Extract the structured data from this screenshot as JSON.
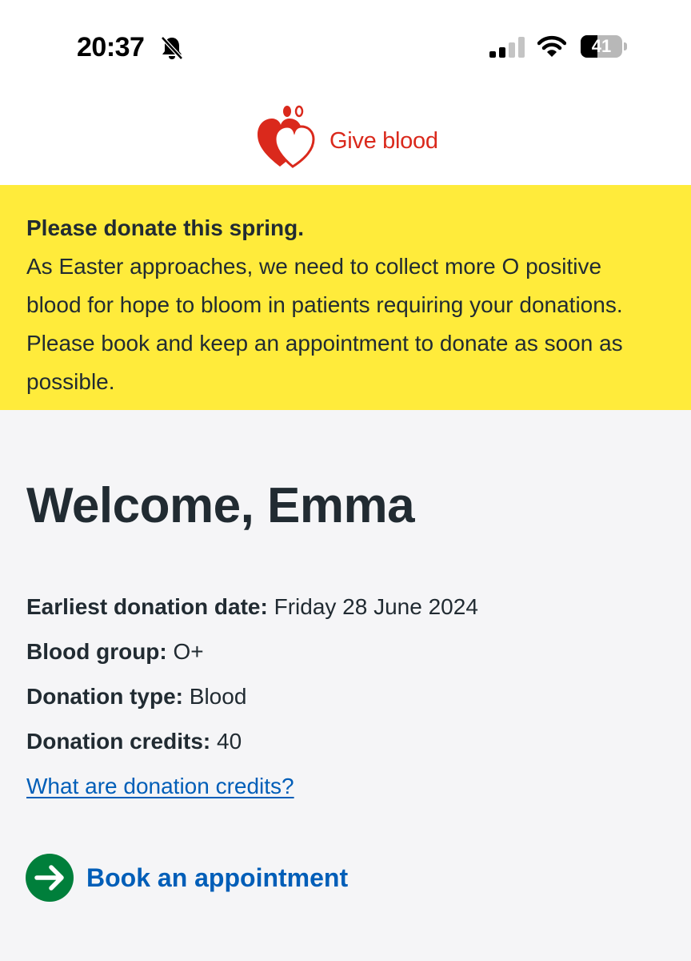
{
  "status_bar": {
    "time": "20:37",
    "battery_level": "41",
    "battery_fraction": 0.41,
    "icons": [
      "bell-slash-icon",
      "cellular-signal-icon",
      "wifi-icon",
      "battery-icon"
    ]
  },
  "header": {
    "logo_text": "Give blood",
    "brand_color": "#da291c"
  },
  "banner": {
    "title": "Please donate this spring.",
    "body": "As Easter approaches, we need to collect more O positive blood for hope to bloom in patients requiring your donations. Please book and keep an appointment to donate as soon as possible.",
    "background_color": "#ffeb3b"
  },
  "welcome": {
    "heading": "Welcome, Emma"
  },
  "details": [
    {
      "label": "Earliest donation date:",
      "value": "Friday 28 June 2024"
    },
    {
      "label": "Blood group:",
      "value": "O+"
    },
    {
      "label": "Donation type:",
      "value": "Blood"
    },
    {
      "label": "Donation credits:",
      "value": "40"
    }
  ],
  "credits_link": "What are donation credits?",
  "book_action": {
    "label": "Book an appointment",
    "icon": "arrow-right-circle-icon",
    "icon_color": "#007f3b",
    "link_color": "#005eb8"
  }
}
